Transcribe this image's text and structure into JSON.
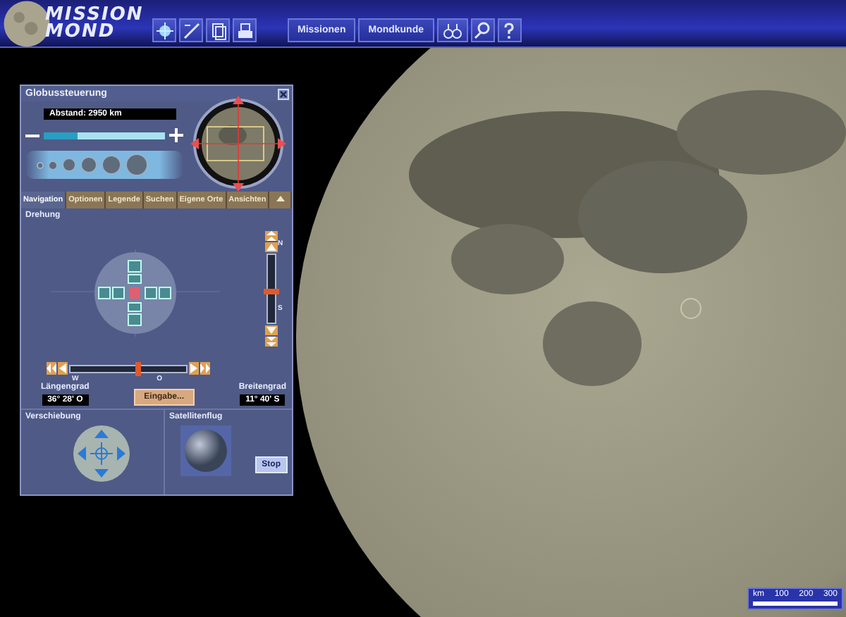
{
  "header": {
    "logo_lines": [
      "MISSION",
      "MOND"
    ],
    "nav_buttons": [
      {
        "label": "Missionen"
      },
      {
        "label": "Mondkunde"
      }
    ]
  },
  "panel": {
    "title": "Globussteuerung",
    "distance": "Abstand: 2950 km",
    "zoom": {
      "level": 0.28
    },
    "tabs": [
      {
        "label": "Navigation",
        "selected": true
      },
      {
        "label": "Optionen",
        "selected": false
      },
      {
        "label": "Legende",
        "selected": false
      },
      {
        "label": "Suchen",
        "selected": false
      },
      {
        "label": "Eigene Orte",
        "selected": false
      },
      {
        "label": "Ansichten",
        "selected": false
      }
    ],
    "rotation": {
      "heading": "Drehung",
      "latitude_slider": {
        "level": 0.45,
        "top_label": "N",
        "bottom_label": "S"
      },
      "longitude_slider": {
        "level": 0.58,
        "left_label": "W",
        "right_label": "O"
      },
      "longitude_label": "Längengrad",
      "longitude_value": "36° 28' O",
      "input_button": "Eingabe...",
      "latitude_label": "Breitengrad",
      "latitude_value": "11° 40' S"
    },
    "shift": {
      "heading": "Verschiebung"
    },
    "satellite": {
      "heading": "Satellitenflug",
      "stop_button": "Stop"
    }
  },
  "scale_bar": {
    "unit": "km",
    "ticks": [
      "100",
      "200",
      "300"
    ]
  }
}
